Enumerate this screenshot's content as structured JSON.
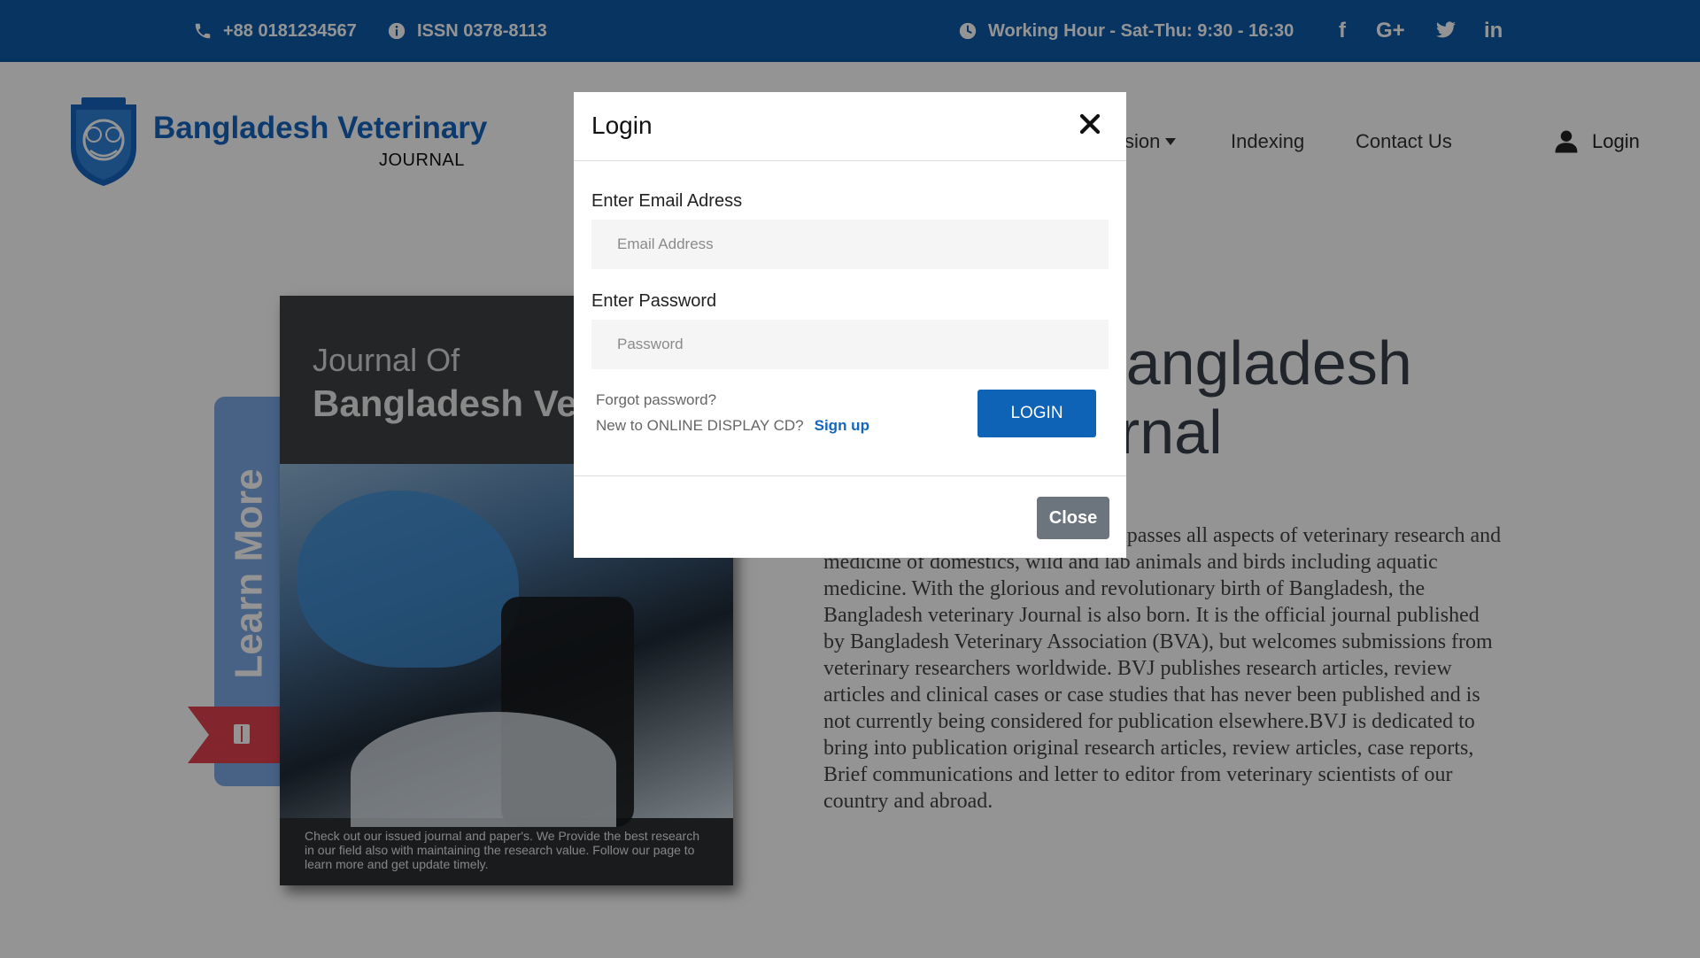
{
  "topbar": {
    "phone": "+88 0181234567",
    "issn": "ISSN 0378-8113",
    "working_hour": "Working Hour - Sat-Thu: 9:30 - 16:30",
    "social": [
      "f",
      "G+",
      "twitter",
      "in"
    ],
    "bg_color": "#0d5aa7"
  },
  "header": {
    "logo_title": "Bangladesh Veterinary",
    "logo_subtitle": "JOURNAL",
    "nav": {
      "submission_partial": "sion",
      "indexing": "Indexing",
      "contact": "Contact Us",
      "login": "Login"
    }
  },
  "hero": {
    "learn_more": "Learn More",
    "book_title_line1": "Journal Of",
    "book_title_line2": "Bangladesh Vet",
    "book_blurb": "Check out our issued journal and paper's. We Provide the best research in our field also with maintaining the research value. Follow our page to learn more and get update timely.",
    "headline_line1": "Bangladesh",
    "headline_line2": "urnal",
    "description": "J) is a peer-reviewed journal encompasses all aspects of veterinary research and medicine of domestics, wild and lab animals and birds including aquatic medicine. With the glorious and revolutionary birth of Bangladesh, the Bangladesh veterinary Journal is also born. It is the official journal published by Bangladesh Veterinary Association (BVA), but welcomes submissions from veterinary researchers worldwide. BVJ publishes research articles, review articles and clinical cases or case studies that has never been published and is not currently being considered for publication elsewhere.BVJ is dedicated to bring into publication original research articles, review articles, case reports, Brief communications and letter to editor from veterinary scientists of our country and abroad."
  },
  "modal": {
    "title": "Login",
    "email_label": "Enter Email Adress",
    "email_placeholder": "Email Address",
    "email_value": "",
    "password_label": "Enter Password",
    "password_placeholder": "Password",
    "password_value": "",
    "forgot": "Forgot password?",
    "new_to": "New to ONLINE DISPLAY CD?",
    "signup": "Sign up",
    "login_button": "LOGIN",
    "close_button": "Close",
    "accent_color": "#0e63b7"
  }
}
